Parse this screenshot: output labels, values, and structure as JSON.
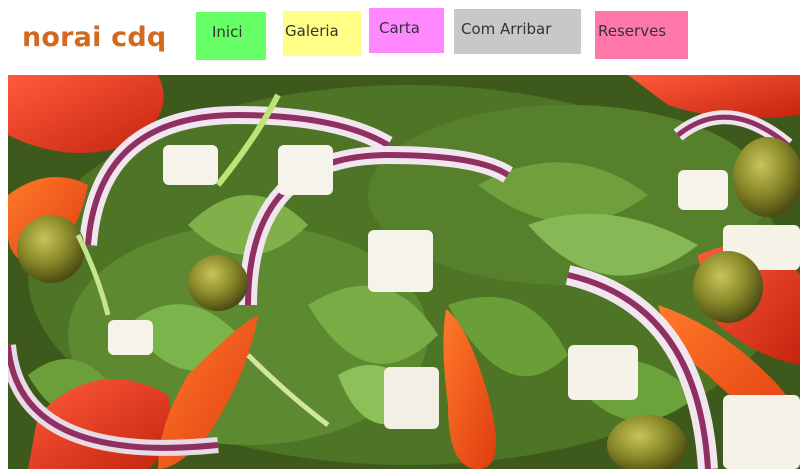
{
  "header": {
    "brand": "norai cdq"
  },
  "nav": {
    "items": [
      {
        "label": "Inici",
        "color": "#66ff66"
      },
      {
        "label": "Galeria",
        "color": "#ffff88"
      },
      {
        "label": "Carta",
        "color": "#ff88ff"
      },
      {
        "label": "Com Arribar",
        "color": "#c8c8c8"
      },
      {
        "label": "Reserves",
        "color": "#ff77a8"
      }
    ]
  },
  "colors": {
    "brand": "#d2691e"
  }
}
